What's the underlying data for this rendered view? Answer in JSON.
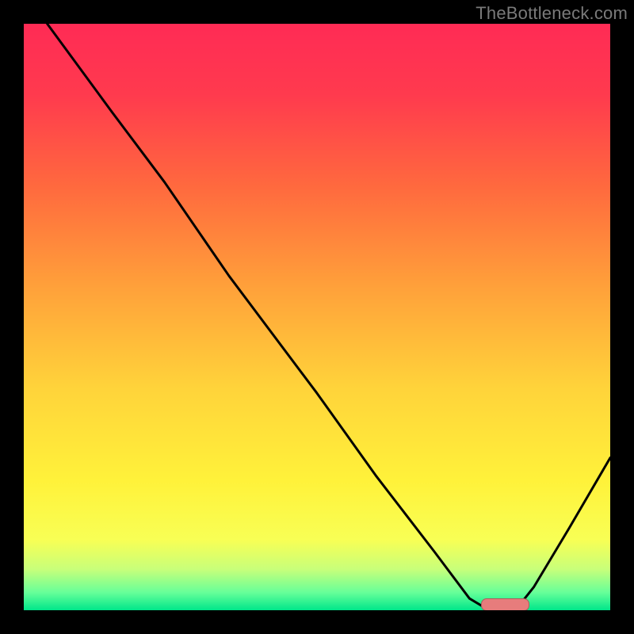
{
  "watermark": "TheBottleneck.com",
  "colors": {
    "frame": "#000000",
    "curve": "#000000",
    "optimum_marker": "#e77c7c",
    "gradient_stops": [
      {
        "offset": 0.0,
        "color": "#ff2b55"
      },
      {
        "offset": 0.12,
        "color": "#ff3a4e"
      },
      {
        "offset": 0.28,
        "color": "#ff6a3e"
      },
      {
        "offset": 0.45,
        "color": "#ffa13a"
      },
      {
        "offset": 0.62,
        "color": "#ffd33a"
      },
      {
        "offset": 0.78,
        "color": "#fff23a"
      },
      {
        "offset": 0.88,
        "color": "#f8ff55"
      },
      {
        "offset": 0.93,
        "color": "#c8ff7a"
      },
      {
        "offset": 0.97,
        "color": "#66ff99"
      },
      {
        "offset": 1.0,
        "color": "#00e68a"
      }
    ]
  },
  "chart_data": {
    "type": "line",
    "title": "",
    "xlabel": "",
    "ylabel": "",
    "xlim": [
      0,
      100
    ],
    "ylim": [
      0,
      100
    ],
    "curve": [
      {
        "x": 4,
        "y": 100
      },
      {
        "x": 15,
        "y": 85
      },
      {
        "x": 24,
        "y": 73
      },
      {
        "x": 35,
        "y": 57
      },
      {
        "x": 50,
        "y": 37
      },
      {
        "x": 60,
        "y": 23
      },
      {
        "x": 70,
        "y": 10
      },
      {
        "x": 76,
        "y": 2
      },
      {
        "x": 79,
        "y": 0.2
      },
      {
        "x": 84,
        "y": 0.2
      },
      {
        "x": 87,
        "y": 4
      },
      {
        "x": 93,
        "y": 14
      },
      {
        "x": 100,
        "y": 26
      }
    ],
    "optimum_range_x": [
      78,
      86
    ]
  }
}
